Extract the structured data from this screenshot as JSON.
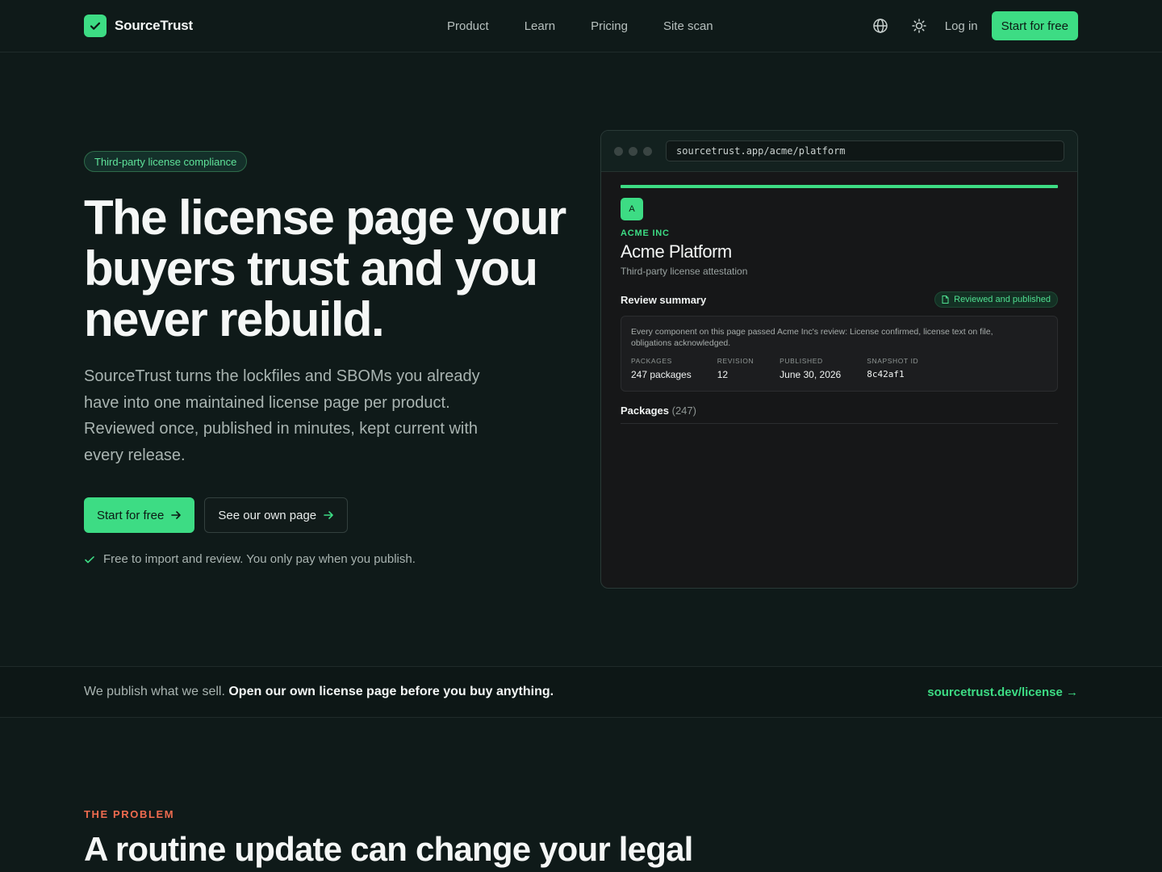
{
  "nav": {
    "brand": "SourceTrust",
    "links": [
      "Product",
      "Learn",
      "Pricing",
      "Site scan"
    ],
    "login": "Log in",
    "cta": "Start for free"
  },
  "hero": {
    "pill": "Third-party license compliance",
    "title": "The license page your buyers trust and you never rebuild.",
    "subtitle": "SourceTrust turns the lockfiles and SBOMs you already have into one maintained license page per product. Reviewed once, published in minutes, kept current with every release.",
    "primary_button": "Start for free",
    "secondary_button": "See our own page",
    "note": "Free to import and review. You only pay when you publish."
  },
  "mock": {
    "url": "sourcetrust.app/acme/platform",
    "avatar": "A",
    "org": "ACME INC",
    "product": "Acme Platform",
    "product_sub": "Third-party license attestation",
    "summary_title": "Review summary",
    "badge": "Reviewed and published",
    "summary_text": "Every component on this page passed Acme Inc's review: License confirmed, license text on file, obligations acknowledged.",
    "stats": [
      {
        "label": "PACKAGES",
        "value": "247 packages"
      },
      {
        "label": "REVISION",
        "value": "12"
      },
      {
        "label": "PUBLISHED",
        "value": "June 30, 2026"
      },
      {
        "label": "SNAPSHOT ID",
        "value": "8c42af1"
      }
    ],
    "packages_label": "Packages",
    "packages_count": "(247)"
  },
  "strip": {
    "text": "We publish what we sell.",
    "strong": "Open our own license page before you buy anything.",
    "link": "sourcetrust.dev/license →"
  },
  "problem": {
    "eyebrow": "THE PROBLEM",
    "title": "A routine update can change your legal"
  },
  "colors": {
    "background": "#0f1a19",
    "accent": "#3ddc84",
    "eyebrow": "#ef6b4f"
  }
}
